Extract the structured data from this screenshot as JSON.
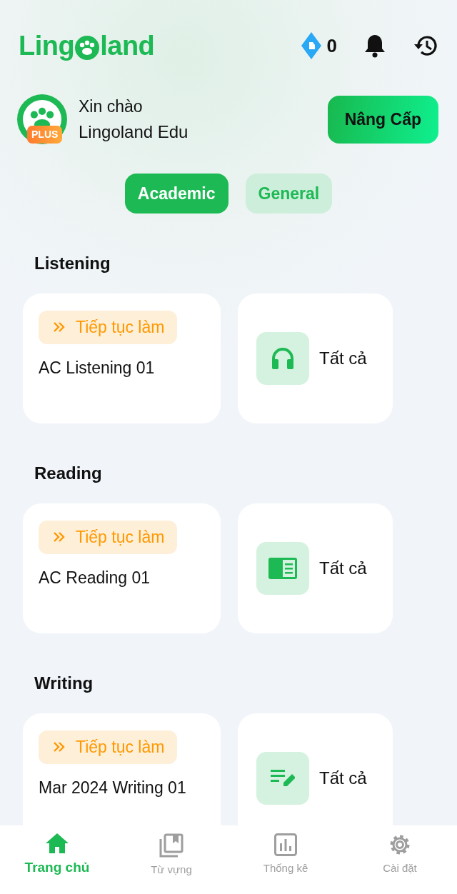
{
  "header": {
    "logo_start": "Ling",
    "logo_end": "land",
    "gems": "0"
  },
  "greeting": {
    "hello": "Xin chào",
    "name": "Lingoland Edu",
    "badge": "PLUS",
    "upgrade": "Nâng Cấp"
  },
  "tabs": [
    {
      "label": "Academic",
      "selected": true
    },
    {
      "label": "General",
      "selected": false
    }
  ],
  "sections": [
    {
      "title": "Listening",
      "resume": "Tiếp tục làm",
      "test": "AC Listening 01",
      "all": "Tất cả"
    },
    {
      "title": "Reading",
      "resume": "Tiếp tục làm",
      "test": "AC Reading 01",
      "all": "Tất cả"
    },
    {
      "title": "Writing",
      "resume": "Tiếp tục làm",
      "test": "Mar 2024 Writing 01",
      "all": "Tất cả"
    }
  ],
  "nav": [
    {
      "label": "Trang chủ",
      "selected": true
    },
    {
      "label": "Từ vựng",
      "selected": false
    },
    {
      "label": "Thống kê",
      "selected": false
    },
    {
      "label": "Cài đặt",
      "selected": false
    }
  ]
}
